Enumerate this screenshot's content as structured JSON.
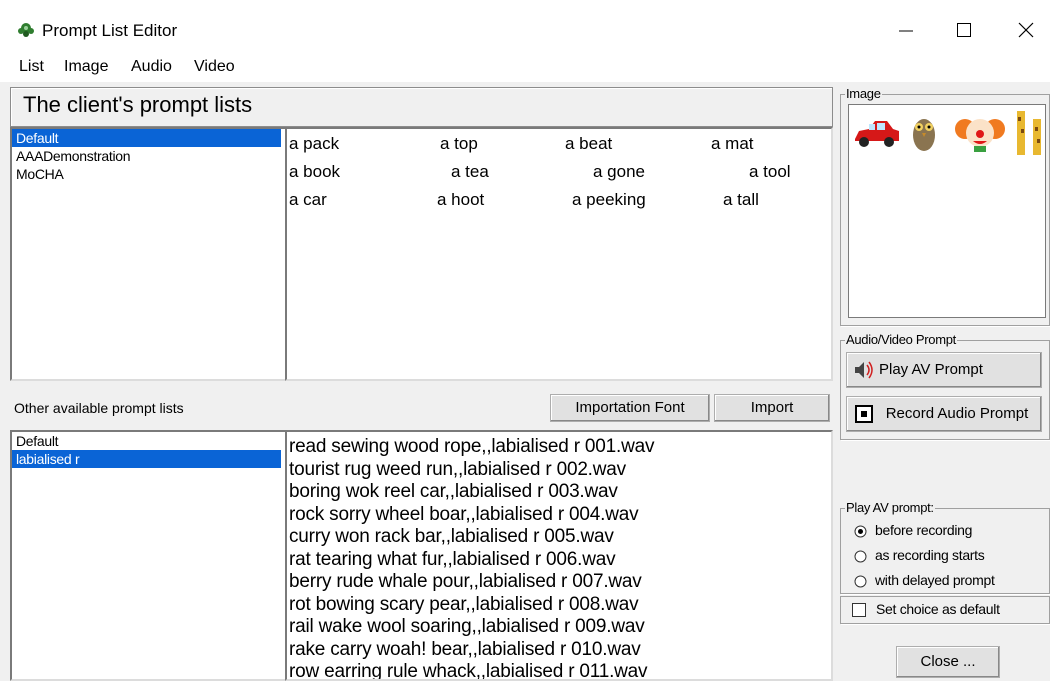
{
  "window": {
    "title": "Prompt List Editor",
    "controls": {
      "minimize": "—",
      "maximize": "☐",
      "close": "✕"
    }
  },
  "menu": [
    "List",
    "Image",
    "Audio",
    "Video"
  ],
  "client_panel": {
    "header": "The client's prompt lists",
    "lists": [
      "Default",
      "AAADemonstration",
      "MoCHA"
    ],
    "selected_index": 0
  },
  "prompt_grid": {
    "rows": [
      [
        "a pack",
        "a top",
        "a beat",
        "a mat"
      ],
      [
        "a book",
        "a tea",
        "a gone",
        "a tool"
      ],
      [
        "a car",
        "a hoot",
        "a peeking",
        "a tall"
      ]
    ]
  },
  "other_panel": {
    "label": "Other available prompt lists",
    "import_font_label": "Importation Font",
    "import_label": "Import",
    "lists": [
      "Default",
      "labialised r"
    ],
    "selected_index": 1
  },
  "wav_files": [
    "read sewing wood rope,,labialised  r  001.wav",
    "tourist rug weed run,,labialised  r  002.wav",
    "boring wok reel car,,labialised  r  003.wav",
    "rock sorry wheel boar,,labialised  r  004.wav",
    "curry won rack bar,,labialised  r  005.wav",
    "rat tearing what fur,,labialised  r  006.wav",
    "berry rude whale pour,,labialised  r  007.wav",
    "rot bowing scary pear,,labialised  r  008.wav",
    "rail wake wool soaring,,labialised  r  009.wav",
    "rake carry woah! bear,,labialised  r  010.wav",
    "row earring rule whack,,labialised  r  011.wav"
  ],
  "image_group": {
    "caption": "Image"
  },
  "av_group": {
    "caption": "Audio/Video Prompt",
    "play_label": "Play AV Prompt",
    "record_label": "Record Audio Prompt"
  },
  "play_options": {
    "caption": "Play AV prompt:",
    "options": [
      "before recording",
      "as recording starts",
      "with delayed prompt"
    ],
    "selected_index": 0
  },
  "default_checkbox": {
    "label": "Set choice as default",
    "checked": false
  },
  "close_button": {
    "label": "Close ..."
  },
  "colors": {
    "selection": "#0a64d6",
    "window_bg": "#f0f0f0",
    "titlebar": "#ffffff"
  }
}
